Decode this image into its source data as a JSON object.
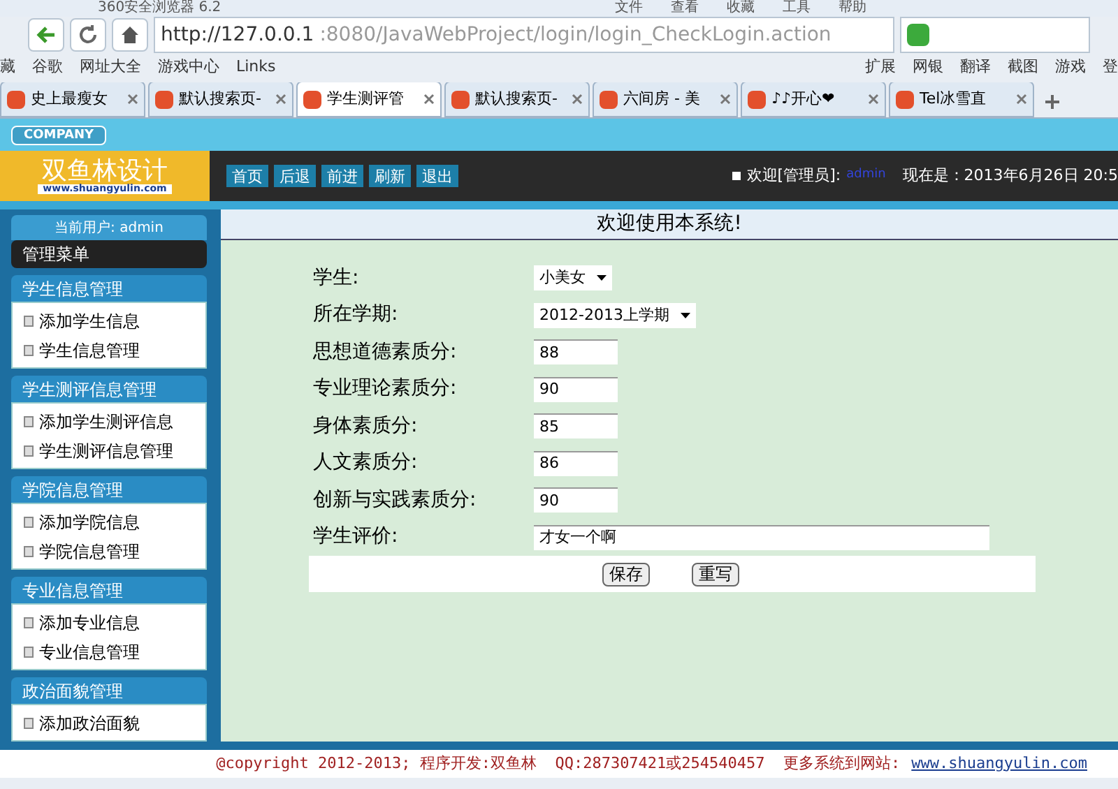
{
  "browser": {
    "title": "360安全浏览器 6.2",
    "menu": [
      "文件",
      "查看",
      "收藏",
      "工具",
      "帮助"
    ],
    "url_host": "http://127.0.0.1",
    "url_rest": ":8080/JavaWebProject/login/login_CheckLogin.action",
    "bookmarks": [
      {
        "label": "藏"
      },
      {
        "label": "谷歌"
      },
      {
        "label": "网址大全"
      },
      {
        "label": "游戏中心"
      },
      {
        "label": "Links"
      }
    ],
    "extensions": [
      {
        "label": "扩展"
      },
      {
        "label": "网银"
      },
      {
        "label": "翻译"
      },
      {
        "label": "截图"
      },
      {
        "label": "游戏"
      },
      {
        "label": "登"
      }
    ],
    "tabs": [
      {
        "label": "史上最瘦女",
        "selected": false
      },
      {
        "label": "默认搜索页-",
        "selected": false
      },
      {
        "label": "学生测评管",
        "selected": true
      },
      {
        "label": "默认搜索页-",
        "selected": false
      },
      {
        "label": "六间房 - 美",
        "selected": false
      },
      {
        "label": "♪♪开心❤",
        "selected": false
      },
      {
        "label": "Tel冰雪直",
        "selected": false
      }
    ]
  },
  "header": {
    "badge": "COMPANY",
    "logo_title": "双鱼林设计",
    "logo_url": "www.shuangyulin.com",
    "nav": [
      "首页",
      "后退",
      "前进",
      "刷新",
      "退出"
    ],
    "welcome": "欢迎[管理员]:",
    "user": "admin",
    "time": "现在是：2013年6月26日 20:5"
  },
  "sidebar": {
    "current_user": "当前用户: admin",
    "menu_title": "管理菜单",
    "groups": [
      {
        "title": "学生信息管理",
        "items": [
          "添加学生信息",
          "学生信息管理"
        ]
      },
      {
        "title": "学生测评信息管理",
        "items": [
          "添加学生测评信息",
          "学生测评信息管理"
        ]
      },
      {
        "title": "学院信息管理",
        "items": [
          "添加学院信息",
          "学院信息管理"
        ]
      },
      {
        "title": "专业信息管理",
        "items": [
          "添加专业信息",
          "专业信息管理"
        ]
      },
      {
        "title": "政治面貌管理",
        "items": [
          "添加政治面貌"
        ]
      }
    ]
  },
  "main": {
    "title": "欢迎使用本系统!",
    "fields": [
      {
        "label": "学生:",
        "kind": "select",
        "value": "小美女"
      },
      {
        "label": "所在学期:",
        "kind": "select",
        "value": "2012-2013上学期"
      },
      {
        "label": "思想道德素质分:",
        "kind": "input",
        "value": "88"
      },
      {
        "label": "专业理论素质分:",
        "kind": "input",
        "value": "90"
      },
      {
        "label": "身体素质分:",
        "kind": "input",
        "value": "85"
      },
      {
        "label": "人文素质分:",
        "kind": "input",
        "value": "86"
      },
      {
        "label": "创新与实践素质分:",
        "kind": "input",
        "value": "90"
      },
      {
        "label": "学生评价:",
        "kind": "wide",
        "value": "才女一个啊"
      }
    ],
    "buttons": [
      "保存",
      "重写"
    ]
  },
  "footer": {
    "text": "@copyright 2012-2013; 程序开发:双鱼林  QQ:287307421或254540457  更多系统到网站:",
    "link": "www.shuangyulin.com"
  }
}
